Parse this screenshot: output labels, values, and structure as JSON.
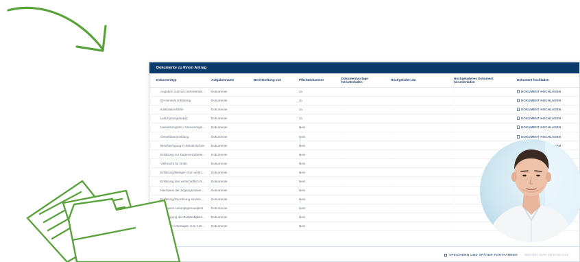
{
  "panel": {
    "title": "Dokumente zu Ihrem Antrag",
    "columns": [
      "Dokumenttyp",
      "Aufgabenname",
      "Bereitstellung von",
      "Pflichtdokument",
      "Dokumentvorlage herunterladen",
      "Hochgeladen am",
      "Hochgeladenes Dokument herunterladen",
      "Dokument hochladen"
    ],
    "upload_label": "DOKUMENT HOCHLADEN",
    "dash": "-",
    "rows": [
      {
        "type": "Angaben zur/zum Vertretenden...",
        "task": "Dokumente",
        "required": "Ja"
      },
      {
        "type": "De-minimis-Erklärung",
        "task": "Dokumente",
        "required": "Ja"
      },
      {
        "type": "Kalkulationshilfe",
        "task": "Dokumente",
        "required": "Ja"
      },
      {
        "type": "Leitungsangebot(e)",
        "task": "Dokumente",
        "required": "Ja"
      },
      {
        "type": "Handelsregister / Vereinsregister...",
        "task": "Dokumente",
        "required": "Nein"
      },
      {
        "type": "Gewerbeanmeldung",
        "task": "Dokumente",
        "required": "Nein"
      },
      {
        "type": "Bescheinigung in Steuersachen",
        "task": "Dokumente",
        "required": "Nein"
      },
      {
        "type": "Erklärung zur Datenverarbeitung",
        "task": "Dokumente",
        "required": "Nein"
      },
      {
        "type": "Vollmacht für Dritte",
        "task": "Dokumente",
        "required": "Nein"
      },
      {
        "type": "Erklärung/Belegen zum wirtschaftl...",
        "task": "Dokumente",
        "required": "Nein"
      },
      {
        "type": "Erklärung des wirtschaftlich Beri...",
        "task": "Dokumente",
        "required": "Nein"
      },
      {
        "type": "Nachweis der Zugangsnotwendigkeit...",
        "task": "Dokumente",
        "required": "Nein"
      },
      {
        "type": "Erklärung/Zuordnung einzelner Tarifv...",
        "task": "Dokumente",
        "required": "Nein"
      },
      {
        "type": "Nachweis Leitungsgenauigkeit",
        "task": "Dokumente",
        "required": "Nein"
      },
      {
        "type": "Bestätigung der Zuständigkeit bz...",
        "task": "Dokumente",
        "required": "Nein"
      },
      {
        "type": "Sonstige Unterlagen zum Antrag",
        "task": "Dokumente",
        "required": "Nein"
      }
    ]
  },
  "footer": {
    "save_label": "SPEICHERN UND SPÄTER FORTFAHREN",
    "next_label": "WEITER ZUM ABSCHLUSS"
  },
  "colors": {
    "header_bg": "#0c3a6b",
    "accent_green": "#5aa23c",
    "link": "#4d6a8c"
  },
  "icons": [
    "curved-arrow-icon",
    "document-icon",
    "folder-icon",
    "save-icon"
  ]
}
